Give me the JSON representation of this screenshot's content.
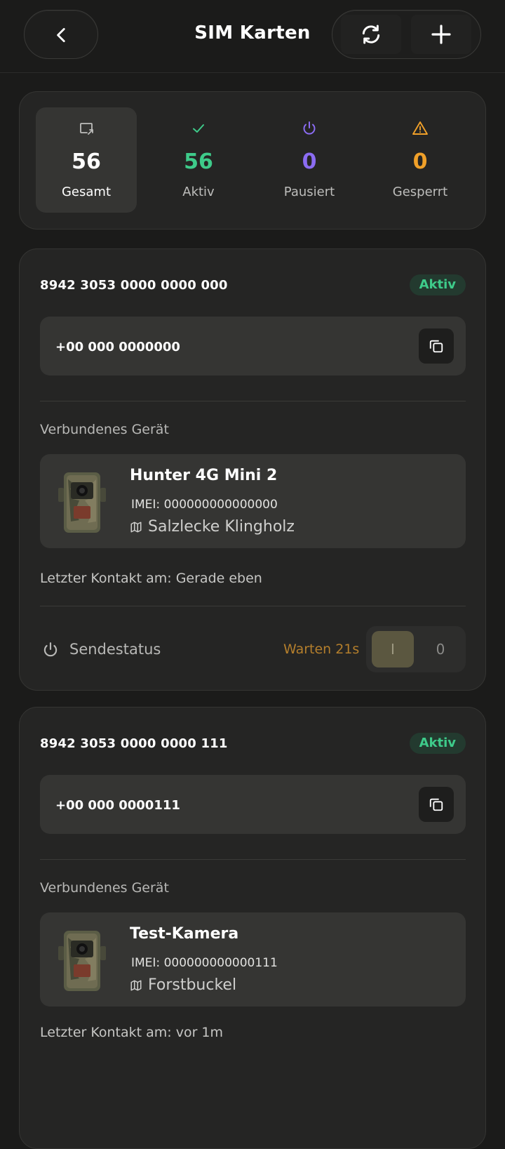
{
  "header": {
    "title": "SIM Karten"
  },
  "stats": [
    {
      "value": "56",
      "label": "Gesamt",
      "color": "#ffffff",
      "icon": "sim-screen-icon"
    },
    {
      "value": "56",
      "label": "Aktiv",
      "color": "#3ecb8a",
      "icon": "check-icon"
    },
    {
      "value": "0",
      "label": "Pausiert",
      "color": "#8b6cf2",
      "icon": "power-icon"
    },
    {
      "value": "0",
      "label": "Gesperrt",
      "color": "#f0a029",
      "icon": "warning-icon"
    }
  ],
  "sims": [
    {
      "iccid": "8942 3053 0000 0000 000",
      "status": "Aktiv",
      "phone": "+00 000 0000000",
      "connected_label": "Verbundenes Gerät",
      "device_name": "Hunter 4G Mini 2",
      "imei": "IMEI: 000000000000000",
      "location": "Salzlecke Klingholz",
      "last_contact": "Letzter Kontakt am: Gerade eben",
      "send_label": "Sendestatus",
      "wait": "Warten 21s",
      "toggle_on": "I",
      "toggle_off": "0"
    },
    {
      "iccid": "8942 3053 0000 0000 111",
      "status": "Aktiv",
      "phone": "+00 000 0000111",
      "connected_label": "Verbundenes Gerät",
      "device_name": "Test-Kamera",
      "imei": "IMEI: 000000000000111",
      "location": "Forstbuckel",
      "last_contact": "Letzter Kontakt am: vor 1m"
    }
  ]
}
